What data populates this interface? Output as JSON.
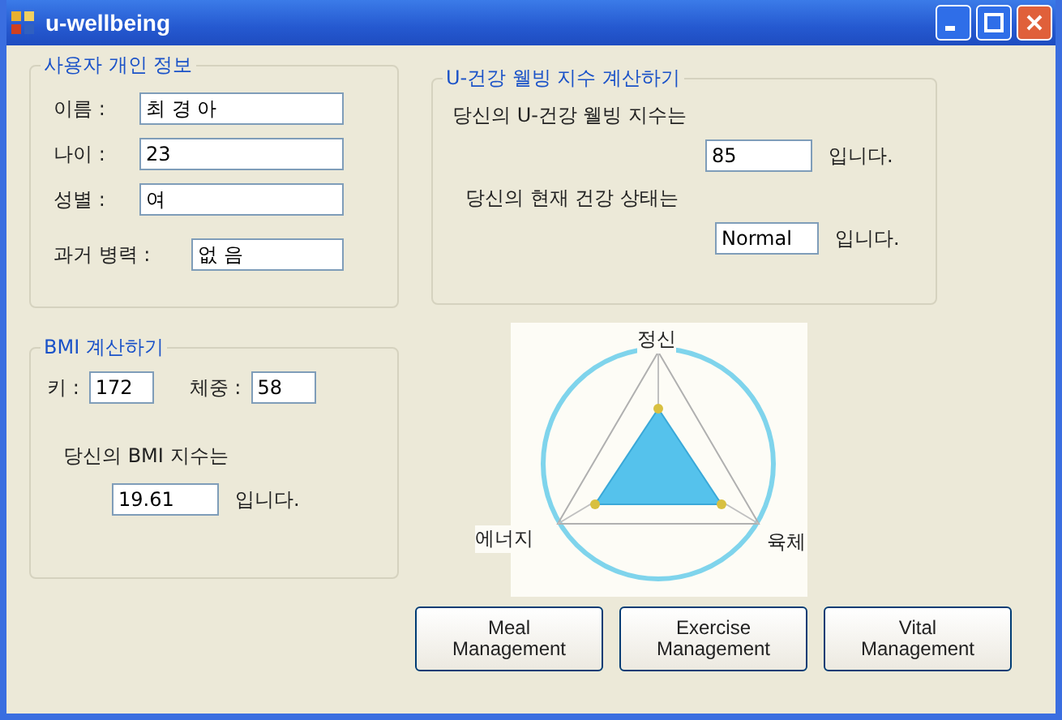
{
  "window": {
    "title": "u-wellbeing"
  },
  "personal_info": {
    "title": "사용자 개인 정보",
    "fields": [
      {
        "label": "이름 :",
        "value": "최 경 아"
      },
      {
        "label": "나이 :",
        "value": "23"
      },
      {
        "label": "성별 :",
        "value": "여"
      },
      {
        "label": "과거 병력 :",
        "value": "없 음"
      }
    ]
  },
  "bmi": {
    "title": "BMI 계산하기",
    "height_label": "키 :",
    "height_value": "172",
    "weight_label": "체중 :",
    "weight_value": "58",
    "prompt": "당신의 BMI 지수는",
    "value": "19.61",
    "suffix": "입니다."
  },
  "wellbeing_index": {
    "title": "U-건강 웰빙 지수 계산하기",
    "index_prompt": "당신의 U-건강 웰빙 지수는",
    "index_value": "85",
    "index_suffix": "입니다.",
    "status_prompt": "당신의 현재 건강 상태는",
    "status_value": "Normal",
    "status_suffix": "입니다."
  },
  "radar": {
    "axes": [
      "정신",
      "육체",
      "에너지"
    ]
  },
  "buttons": [
    "Meal Management",
    "Exercise Management",
    "Vital Management"
  ]
}
